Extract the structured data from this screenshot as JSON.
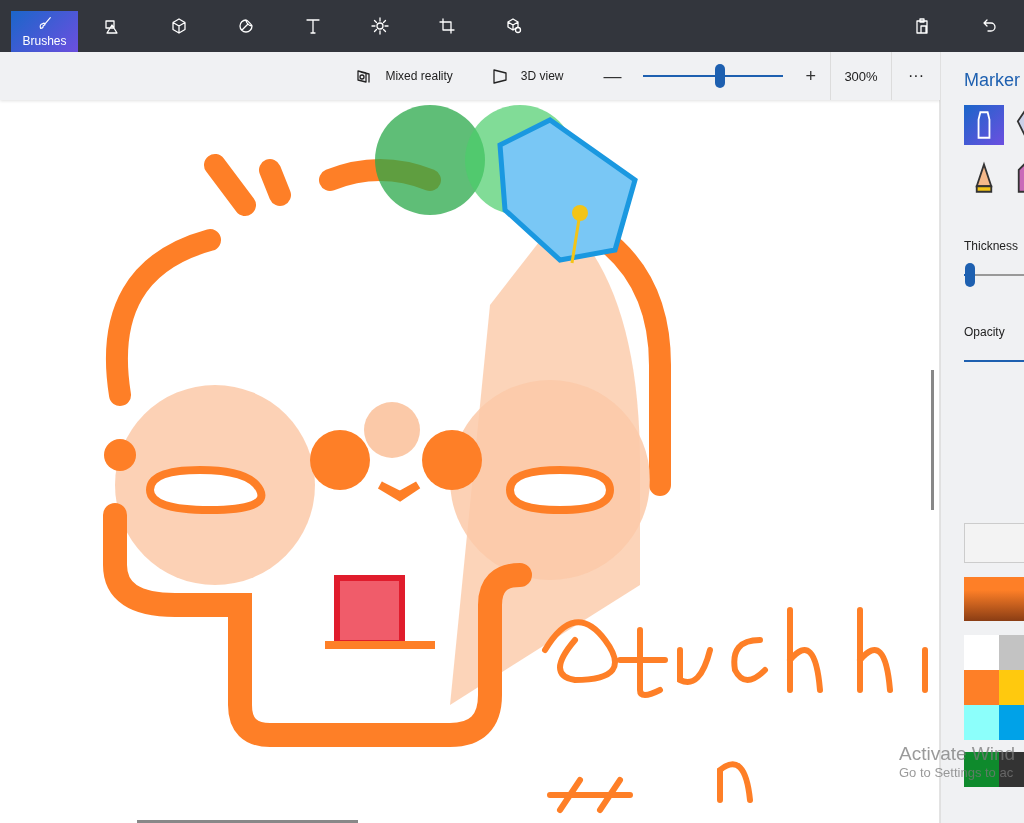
{
  "toolbar": {
    "tools": [
      {
        "kind": "brushes",
        "label": "Brushes",
        "selected": true
      },
      {
        "kind": "shapes2d",
        "selected": false
      },
      {
        "kind": "shapes3d",
        "selected": false
      },
      {
        "kind": "stickers",
        "selected": false
      },
      {
        "kind": "text",
        "selected": false
      },
      {
        "kind": "effects",
        "selected": false
      },
      {
        "kind": "canvas",
        "selected": false
      },
      {
        "kind": "library",
        "selected": false
      }
    ],
    "actions": [
      {
        "kind": "paste"
      },
      {
        "kind": "undo"
      }
    ]
  },
  "view_bar": {
    "mixed_reality": {
      "label": "Mixed reality"
    },
    "view_3d": {
      "label": "3D view"
    },
    "zoom": {
      "minus": "—",
      "plus": "+",
      "level": 0.55,
      "reading": "300%"
    },
    "more": "···"
  },
  "panel": {
    "title": "Marker",
    "brushes": [
      {
        "kind": "marker",
        "selected": true
      },
      {
        "kind": "pen",
        "selected": false
      },
      {
        "kind": "pencil",
        "selected": false
      },
      {
        "kind": "crayon",
        "selected": false
      }
    ],
    "thickness": {
      "label": "Thickness",
      "level": 0.04
    },
    "opacity": {
      "label": "Opacity",
      "level": 1
    },
    "current_color": {
      "color": "#fe7f27"
    },
    "palette": [
      {
        "color": "#ffffff"
      },
      {
        "color": "#c3c3c3"
      },
      {
        "color": "#fe7f27"
      },
      {
        "color": "#ffc90e"
      },
      {
        "color": "#8cfffb"
      },
      {
        "color": "#00a2e8"
      },
      {
        "color": "#0e8a2c"
      },
      {
        "color": "#333333"
      }
    ]
  },
  "activation_notice": {
    "title": "Activate Wind",
    "subtitle": "Go to Settings to ac"
  }
}
